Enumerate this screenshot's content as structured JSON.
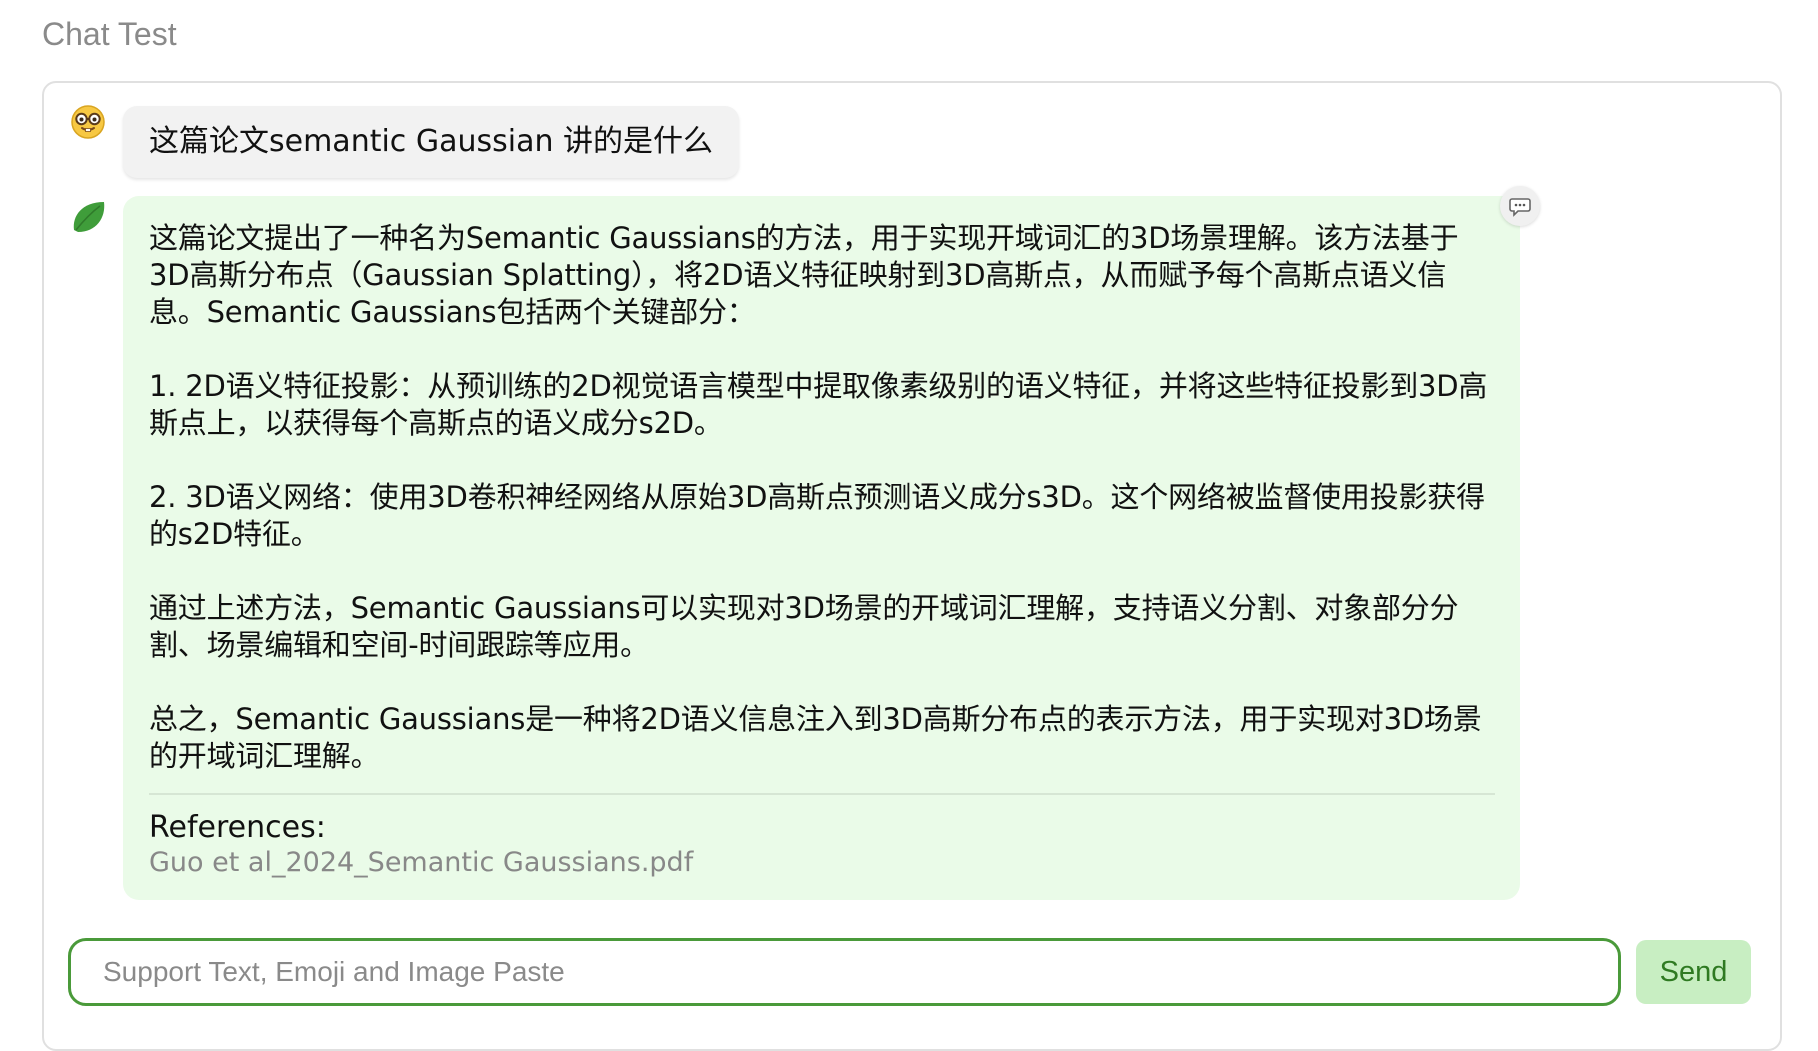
{
  "app": {
    "title": "Chat Test"
  },
  "messages": {
    "user": {
      "avatar_icon": "nerd-face-emoji",
      "text": "这篇论文semantic Gaussian 讲的是什么"
    },
    "assistant": {
      "avatar_icon": "green-leaf-icon",
      "action_icon": "speech-bubble-icon",
      "paragraphs": [
        "这篇论文提出了一种名为Semantic Gaussians的方法，用于实现开域词汇的3D场景理解。该方法基于3D高斯分布点（Gaussian Splatting），将2D语义特征映射到3D高斯点，从而赋予每个高斯点语义信息。Semantic Gaussians包括两个关键部分：",
        "1. 2D语义特征投影：从预训练的2D视觉语言模型中提取像素级别的语义特征，并将这些特征投影到3D高斯点上，以获得每个高斯点的语义成分s2D。",
        "2. 3D语义网络：使用3D卷积神经网络从原始3D高斯点预测语义成分s3D。这个网络被监督使用投影获得的s2D特征。",
        "通过上述方法，Semantic Gaussians可以实现对3D场景的开域词汇理解，支持语义分割、对象部分分割、场景编辑和空间-时间跟踪等应用。",
        "总之，Semantic Gaussians是一种将2D语义信息注入到3D高斯分布点的表示方法，用于实现对3D场景的开域词汇理解。"
      ],
      "references_label": "References:",
      "reference_file": "Guo et al_2024_Semantic Gaussians.pdf"
    }
  },
  "composer": {
    "placeholder": "Support Text, Emoji and Image Paste",
    "value": "",
    "send_label": "Send"
  },
  "colors": {
    "user_bubble": "#f2f2f2",
    "assistant_bubble": "#eafbe8",
    "accent": "#4a9a3a",
    "send_button": "#c8eec2"
  }
}
